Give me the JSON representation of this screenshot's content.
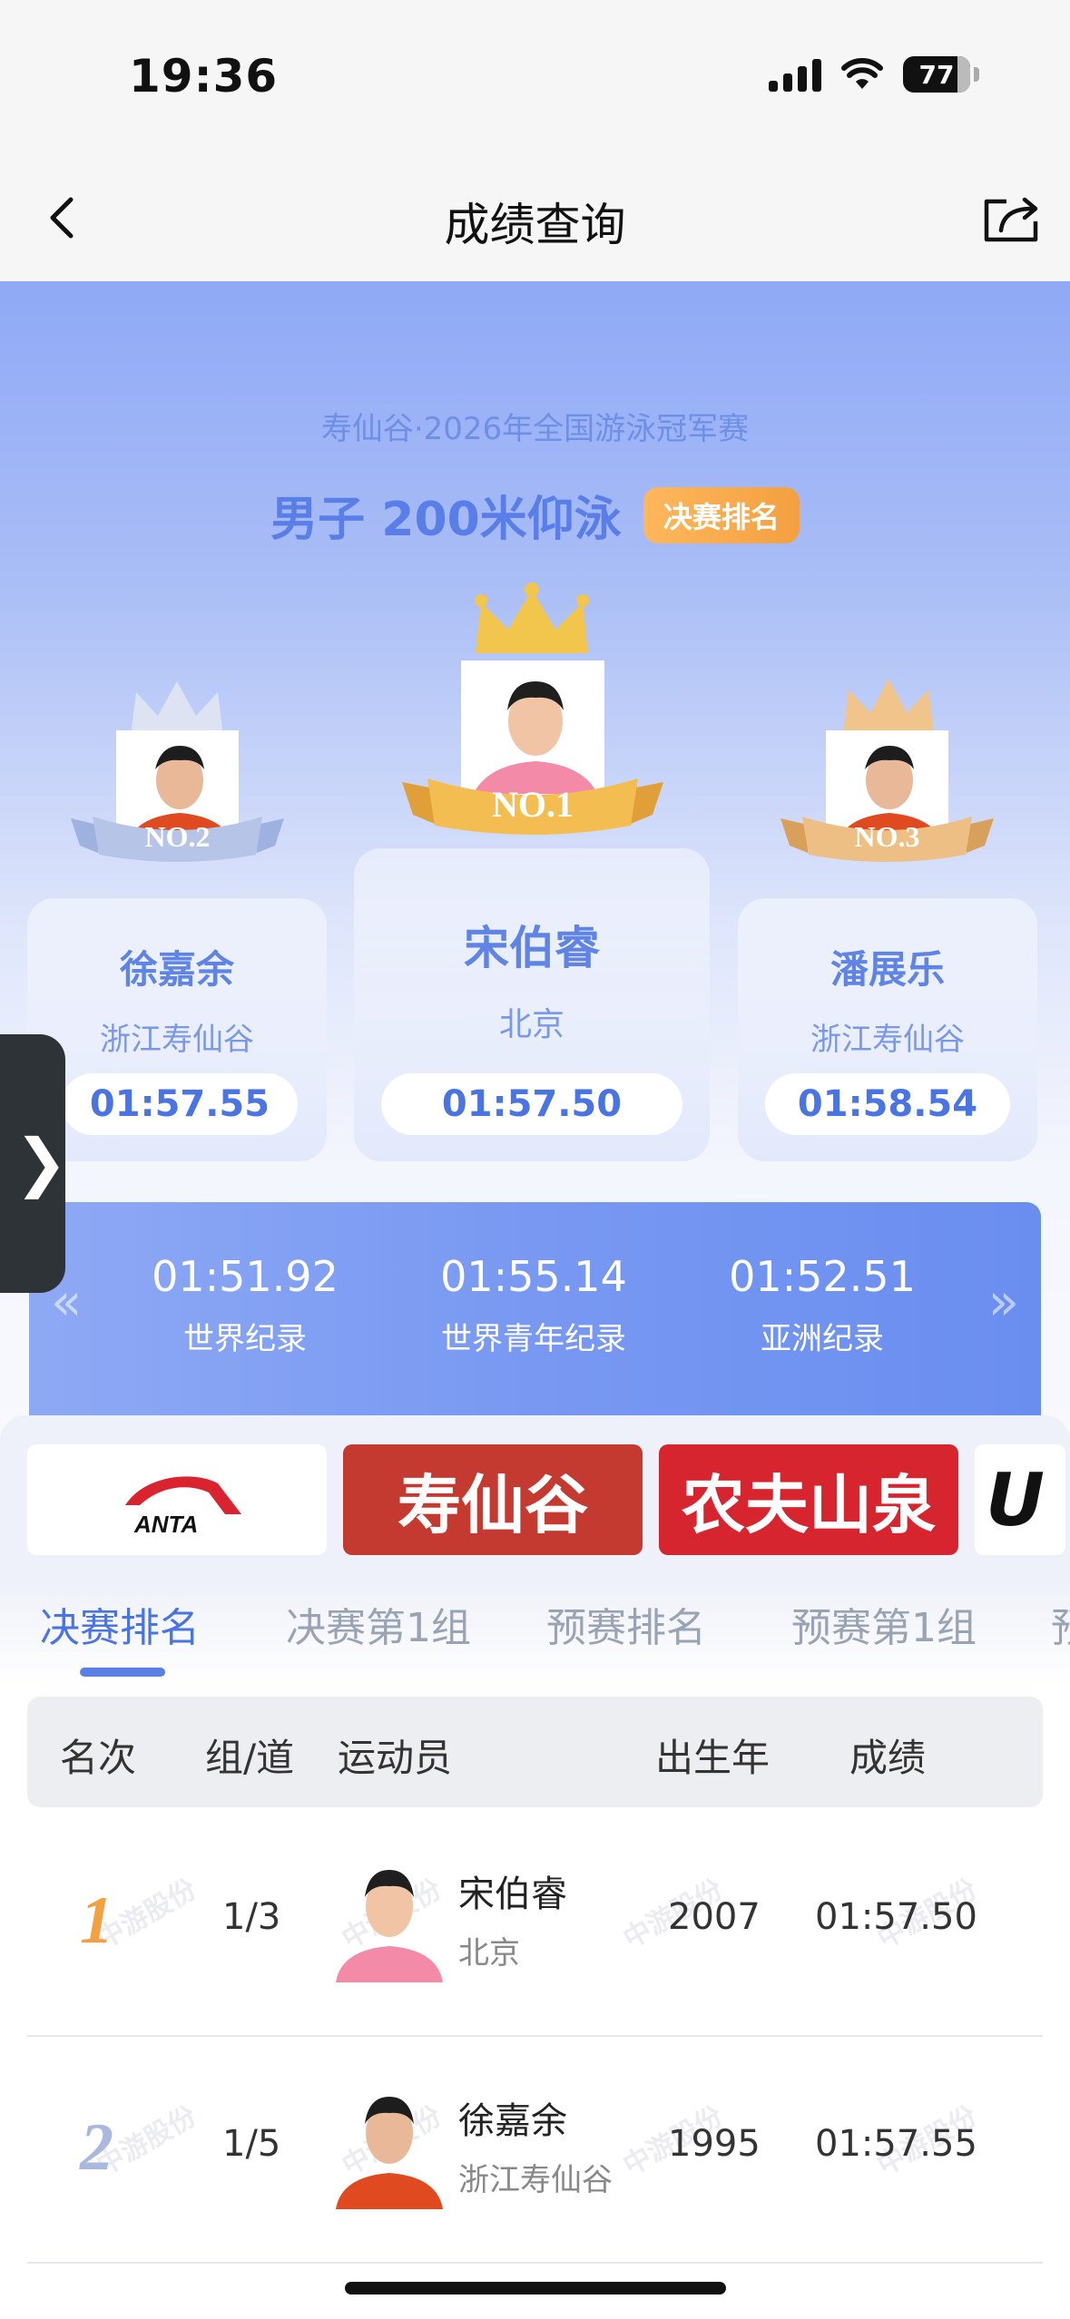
{
  "status_bar": {
    "time": "19:36",
    "battery": "77"
  },
  "nav": {
    "title": "成绩查询"
  },
  "event": {
    "subtitle": "寿仙谷·2026年全国游泳冠军赛",
    "title": "男子 200米仰泳",
    "badge": "决赛排名"
  },
  "podium": {
    "first": {
      "ribbon": "NO.1",
      "name": "宋伯睿",
      "team": "北京",
      "time": "01:57.50"
    },
    "second": {
      "ribbon": "NO.2",
      "name": "徐嘉余",
      "team": "浙江寿仙谷",
      "time": "01:57.55"
    },
    "third": {
      "ribbon": "NO.3",
      "name": "潘展乐",
      "team": "浙江寿仙谷",
      "time": "01:58.54"
    }
  },
  "records": [
    {
      "time": "01:51.92",
      "label": "世界纪录"
    },
    {
      "time": "01:55.14",
      "label": "世界青年纪录"
    },
    {
      "time": "01:52.51",
      "label": "亚洲纪录"
    }
  ],
  "sponsors": {
    "anta": "ANTA",
    "sxg": "寿仙谷",
    "nfsq": "农夫山泉",
    "u": "U"
  },
  "tabs": [
    "决赛排名",
    "决赛第1组",
    "预赛排名",
    "预赛第1组",
    "预"
  ],
  "table": {
    "headers": [
      "名次",
      "组/道",
      "运动员",
      "出生年",
      "成绩"
    ],
    "rows": [
      {
        "rank": "1",
        "lane": "1/3",
        "name": "宋伯睿",
        "team": "北京",
        "birth": "2007",
        "time": "01:57.50"
      },
      {
        "rank": "2",
        "lane": "1/5",
        "name": "徐嘉余",
        "team": "浙江寿仙谷",
        "birth": "1995",
        "time": "01:57.55"
      }
    ]
  },
  "watermark": "中游股份",
  "colors": {
    "accent": "#4a74e4",
    "gold": "#f3a040",
    "silver": "#a9b8dc",
    "bronze": "#e0a864"
  }
}
